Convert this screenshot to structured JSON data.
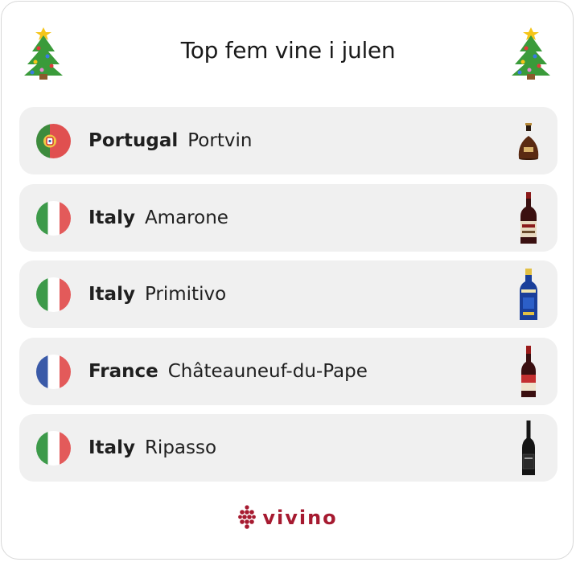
{
  "header": {
    "title": "Top fem vine i julen",
    "left_icon": "christmas-tree-icon",
    "right_icon": "christmas-tree-icon"
  },
  "rows": [
    {
      "country": "Portugal",
      "wine": "Portvin",
      "flag": "portugal-flag-icon",
      "bottle": "cognac-decanter-bottle-icon"
    },
    {
      "country": "Italy",
      "wine": "Amarone",
      "flag": "italy-flag-icon",
      "bottle": "red-wine-bottle-icon"
    },
    {
      "country": "Italy",
      "wine": "Primitivo",
      "flag": "italy-flag-icon",
      "bottle": "blue-wine-bottle-icon"
    },
    {
      "country": "France",
      "wine": "Châteauneuf-du-Pape",
      "flag": "france-flag-icon",
      "bottle": "red-wine-bottle-icon"
    },
    {
      "country": "Italy",
      "wine": "Ripasso",
      "flag": "italy-flag-icon",
      "bottle": "dark-wine-bottle-icon"
    }
  ],
  "footer": {
    "brand": "vivino",
    "brand_color": "#a61a30"
  }
}
